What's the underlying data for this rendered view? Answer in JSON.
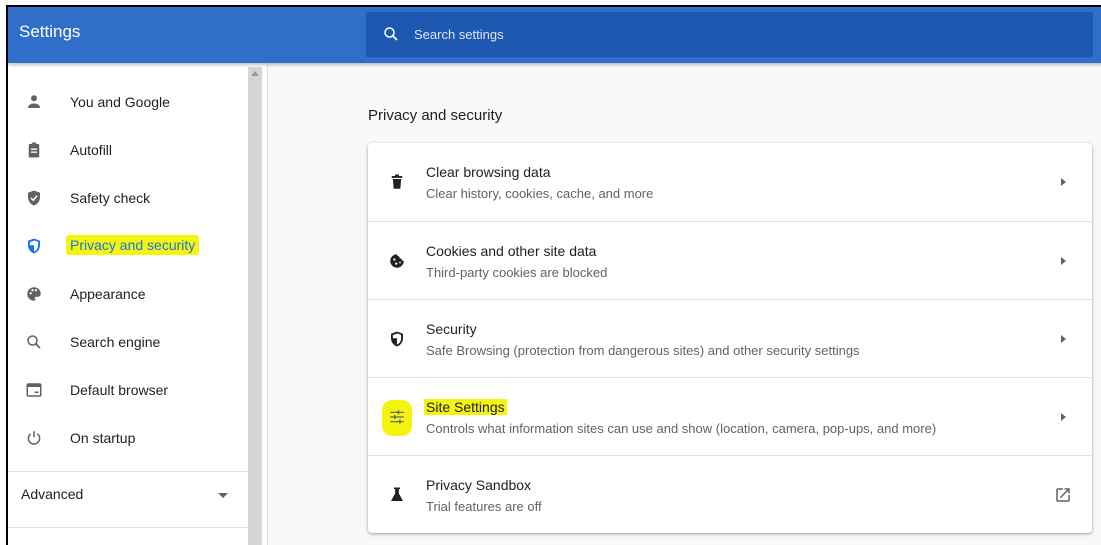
{
  "app": {
    "title": "Settings"
  },
  "search": {
    "placeholder": "Search settings"
  },
  "sidebar": {
    "items": [
      {
        "label": "You and Google",
        "icon": "person-icon"
      },
      {
        "label": "Autofill",
        "icon": "clipboard-icon"
      },
      {
        "label": "Safety check",
        "icon": "shield-check-icon"
      },
      {
        "label": "Privacy and security",
        "icon": "shield-icon",
        "active": true,
        "highlighted": true
      },
      {
        "label": "Appearance",
        "icon": "palette-icon"
      },
      {
        "label": "Search engine",
        "icon": "search-icon"
      },
      {
        "label": "Default browser",
        "icon": "browser-icon"
      },
      {
        "label": "On startup",
        "icon": "power-icon"
      }
    ],
    "advanced_label": "Advanced"
  },
  "main": {
    "section_title": "Privacy and security",
    "rows": [
      {
        "title": "Clear browsing data",
        "subtitle": "Clear history, cookies, cache, and more",
        "icon": "trash-icon",
        "action": "chevron-right-icon"
      },
      {
        "title": "Cookies and other site data",
        "subtitle": "Third-party cookies are blocked",
        "icon": "cookie-icon",
        "action": "chevron-right-icon"
      },
      {
        "title": "Security",
        "subtitle": "Safe Browsing (protection from dangerous sites) and other security settings",
        "icon": "shield-icon",
        "action": "chevron-right-icon"
      },
      {
        "title": "Site Settings",
        "subtitle": "Controls what information sites can use and show (location, camera, pop-ups, and more)",
        "icon": "sliders-icon",
        "action": "chevron-right-icon",
        "highlighted": true
      },
      {
        "title": "Privacy Sandbox",
        "subtitle": "Trial features are off",
        "icon": "flask-icon",
        "action": "open-in-new-icon"
      }
    ]
  },
  "colors": {
    "header": "#2f6ec9",
    "search_bg": "#1f58b0",
    "active_blue": "#1a73e8",
    "highlight_yellow": "#f4f40f"
  }
}
